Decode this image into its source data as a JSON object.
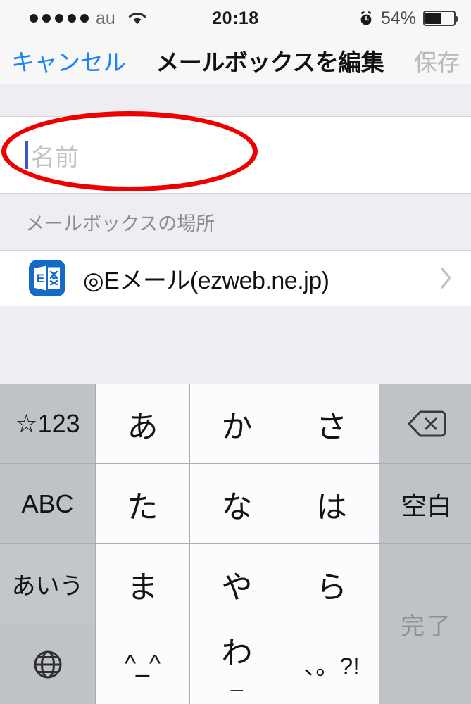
{
  "status_bar": {
    "signal_dots": 5,
    "carrier": "au",
    "wifi_icon": "wifi-icon",
    "time": "20:18",
    "alarm_icon": "alarm-clock-icon",
    "battery_percent": "54%",
    "battery_level": 54
  },
  "nav_bar": {
    "cancel_label": "キャンセル",
    "title": "メールボックスを編集",
    "save_label": "保存",
    "cancel_color": "#1b83f7",
    "save_color": "#b9b9bd"
  },
  "form": {
    "name_field": {
      "value": "",
      "placeholder": "名前",
      "caret_color": "#3a57c8"
    },
    "section_header": "メールボックスの場所",
    "location_row": {
      "icon": "microsoft-exchange-icon",
      "label": "◎Eメール(ezweb.ne.jp)",
      "chevron": "chevron-right-icon"
    }
  },
  "annotation": {
    "shape": "ellipse",
    "color": "#ee0000",
    "target": "name-input-field"
  },
  "keyboard": {
    "type": "japanese-kana-10key",
    "rows": [
      [
        {
          "name": "key-symbols-123",
          "label": "☆123",
          "kind": "fn"
        },
        {
          "name": "key-a",
          "label": "あ",
          "kind": "char"
        },
        {
          "name": "key-ka",
          "label": "か",
          "kind": "char"
        },
        {
          "name": "key-sa",
          "label": "さ",
          "kind": "char"
        },
        {
          "name": "key-delete",
          "label": "",
          "kind": "icon-backspace"
        }
      ],
      [
        {
          "name": "key-abc",
          "label": "ABC",
          "kind": "fn"
        },
        {
          "name": "key-ta",
          "label": "た",
          "kind": "char"
        },
        {
          "name": "key-na",
          "label": "な",
          "kind": "char"
        },
        {
          "name": "key-ha",
          "label": "は",
          "kind": "char"
        },
        {
          "name": "key-space",
          "label": "空白",
          "kind": "fn"
        }
      ],
      [
        {
          "name": "key-aiu",
          "label": "あいう",
          "kind": "fn-light"
        },
        {
          "name": "key-ma",
          "label": "ま",
          "kind": "char"
        },
        {
          "name": "key-ya",
          "label": "や",
          "kind": "char"
        },
        {
          "name": "key-ra",
          "label": "ら",
          "kind": "char"
        },
        {
          "name": "key-done",
          "label": "完了",
          "kind": "done"
        }
      ],
      [
        {
          "name": "key-globe",
          "label": "",
          "kind": "icon-globe"
        },
        {
          "name": "key-emoticon",
          "label": "^_^",
          "kind": "char"
        },
        {
          "name": "key-wa",
          "label": "わ",
          "sub": "_",
          "kind": "char-stack"
        },
        {
          "name": "key-punctuation",
          "label": "、。?!",
          "kind": "char-small"
        }
      ]
    ]
  }
}
